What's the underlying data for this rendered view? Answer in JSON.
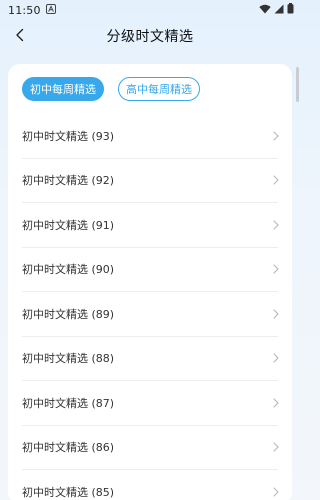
{
  "status_bar": {
    "time": "11:50"
  },
  "nav": {
    "title": "分级时文精选"
  },
  "tabs": [
    {
      "label": "初中每周精选",
      "active": true
    },
    {
      "label": "高中每周精选",
      "active": false
    }
  ],
  "list": [
    {
      "label": "初中时文精选 (93)"
    },
    {
      "label": "初中时文精选 (92)"
    },
    {
      "label": "初中时文精选 (91)"
    },
    {
      "label": "初中时文精选 (90)"
    },
    {
      "label": "初中时文精选 (89)"
    },
    {
      "label": "初中时文精选 (88)"
    },
    {
      "label": "初中时文精选 (87)"
    },
    {
      "label": "初中时文精选 (86)"
    },
    {
      "label": "初中时文精选 (85)"
    }
  ],
  "icons": {
    "back": "chevron-left-icon",
    "item_arrow": "chevron-right-icon",
    "notification": "font-a-notification-icon",
    "wifi": "wifi-icon",
    "cellular": "cellular-signal-icon",
    "battery": "battery-icon"
  },
  "colors": {
    "accent": "#37a8ec",
    "background_top": "#e4f1fd",
    "card": "#ffffff"
  }
}
